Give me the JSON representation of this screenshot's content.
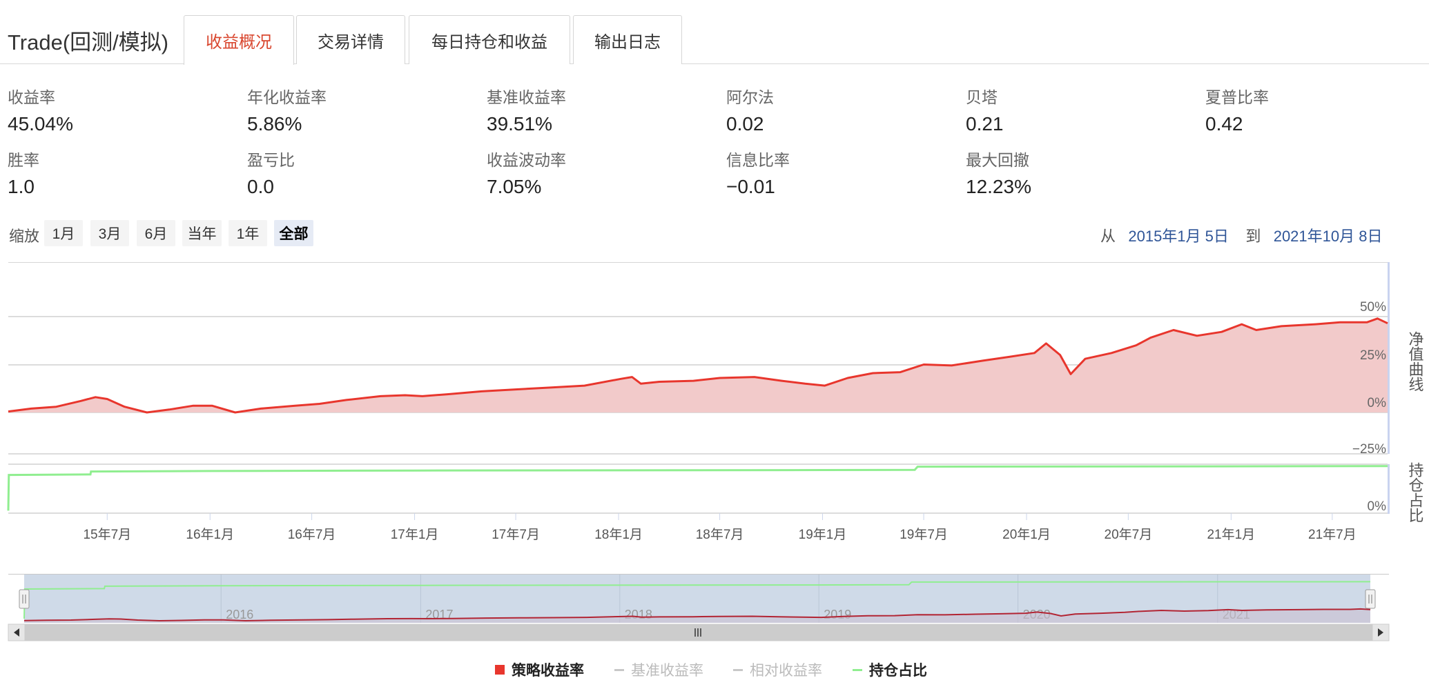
{
  "app_title": "Trade(回测/模拟)",
  "tabs": [
    {
      "label": "收益概况",
      "active": true
    },
    {
      "label": "交易详情",
      "active": false
    },
    {
      "label": "每日持仓和收益",
      "active": false
    },
    {
      "label": "输出日志",
      "active": false
    }
  ],
  "metrics": [
    {
      "label": "收益率",
      "value": "45.04%"
    },
    {
      "label": "年化收益率",
      "value": "5.86%"
    },
    {
      "label": "基准收益率",
      "value": "39.51%"
    },
    {
      "label": "阿尔法",
      "value": "0.02"
    },
    {
      "label": "贝塔",
      "value": "0.21"
    },
    {
      "label": "夏普比率",
      "value": "0.42"
    },
    {
      "label": "胜率",
      "value": "1.0"
    },
    {
      "label": "盈亏比",
      "value": "0.0"
    },
    {
      "label": "收益波动率",
      "value": "7.05%"
    },
    {
      "label": "信息比率",
      "value": "−0.01"
    },
    {
      "label": "最大回撤",
      "value": "12.23%"
    }
  ],
  "zoom": {
    "label": "缩放",
    "buttons": [
      "1月",
      "3月",
      "6月",
      "当年",
      "1年",
      "全部"
    ],
    "active_index": 5
  },
  "date_range": {
    "from_label": "从",
    "from": "2015年1月 5日",
    "to_label": "到",
    "to": "2021年10月 8日"
  },
  "colors": {
    "strategy": "#e8362d",
    "strategy_fill": "#f2caca",
    "position": "#90ee90",
    "accent": "#d9472f",
    "link": "#2f5597"
  },
  "chart_data": {
    "type": "line",
    "y_axis_title": "净值曲线",
    "y_ticks": [
      "50%",
      "25%",
      "0%",
      "−25%"
    ],
    "ylim": [
      -25,
      50
    ],
    "position_axis_title": "持仓占比",
    "position_ticks": [
      "0%"
    ],
    "x_ticks": [
      "15年7月",
      "16年1月",
      "16年7月",
      "17年1月",
      "17年7月",
      "18年1月",
      "18年7月",
      "19年1月",
      "19年7月",
      "20年1月",
      "20年7月",
      "21年1月",
      "21年7月"
    ],
    "navigator_ticks": [
      "2016",
      "2017",
      "2018",
      "2019",
      "2020",
      "2021"
    ],
    "series": [
      {
        "name": "策略收益率",
        "x": [
          "2015-01-05",
          "2015-02-15",
          "2015-04-01",
          "2015-05-15",
          "2015-06-10",
          "2015-07-01",
          "2015-08-01",
          "2015-09-10",
          "2015-10-20",
          "2015-12-01",
          "2016-01-05",
          "2016-02-15",
          "2016-04-01",
          "2016-06-01",
          "2016-07-15",
          "2016-09-01",
          "2016-11-01",
          "2016-12-15",
          "2017-01-15",
          "2017-03-01",
          "2017-05-01",
          "2017-07-01",
          "2017-09-01",
          "2017-11-01",
          "2018-01-05",
          "2018-01-25",
          "2018-02-10",
          "2018-03-15",
          "2018-05-15",
          "2018-07-01",
          "2018-09-01",
          "2018-10-20",
          "2018-12-01",
          "2019-01-05",
          "2019-02-15",
          "2019-04-01",
          "2019-05-20",
          "2019-07-01",
          "2019-08-20",
          "2019-10-15",
          "2019-12-01",
          "2020-01-15",
          "2020-02-05",
          "2020-03-01",
          "2020-03-20",
          "2020-04-15",
          "2020-06-01",
          "2020-07-15",
          "2020-08-10",
          "2020-09-20",
          "2020-11-01",
          "2020-12-15",
          "2021-01-20",
          "2021-02-15",
          "2021-04-01",
          "2021-06-01",
          "2021-07-15",
          "2021-09-01",
          "2021-09-20",
          "2021-10-08"
        ],
        "values": [
          0.5,
          2.0,
          3.0,
          6.0,
          8.0,
          7.0,
          3.0,
          0.0,
          1.5,
          3.5,
          3.5,
          0.0,
          2.0,
          3.5,
          4.5,
          6.5,
          8.5,
          9.0,
          8.5,
          9.5,
          11.0,
          12.0,
          13.0,
          14.0,
          17.5,
          18.5,
          15.0,
          16.0,
          16.5,
          18.0,
          18.5,
          16.5,
          15.0,
          14.0,
          18.0,
          20.5,
          21.0,
          25.0,
          24.5,
          27.0,
          29.0,
          31.0,
          36.0,
          30.0,
          20.0,
          28.0,
          31.0,
          35.0,
          39.0,
          43.0,
          40.0,
          42.0,
          46.0,
          43.0,
          45.0,
          46.0,
          47.0,
          47.0,
          49.0,
          46.5
        ]
      },
      {
        "name": "持仓占比",
        "x": [
          "2015-01-05",
          "2015-01-06",
          "2015-06-01",
          "2015-06-02",
          "2016-01-01",
          "2017-01-01",
          "2018-01-01",
          "2019-01-01",
          "2019-06-15",
          "2019-06-20",
          "2021-10-08"
        ],
        "values": [
          5,
          78,
          79,
          85,
          86,
          87,
          87.5,
          88,
          88.5,
          95,
          96
        ]
      }
    ]
  },
  "legend": [
    {
      "label": "策略收益率",
      "color": "#e8362d",
      "enabled": true
    },
    {
      "label": "基准收益率",
      "color": "#c8c8c8",
      "enabled": false
    },
    {
      "label": "相对收益率",
      "color": "#c8c8c8",
      "enabled": false
    },
    {
      "label": "持仓占比",
      "color": "#90ee90",
      "enabled": true
    }
  ]
}
